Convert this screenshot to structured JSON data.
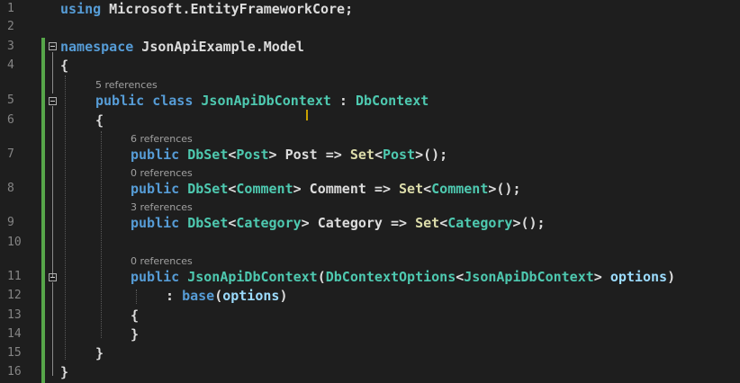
{
  "line_numbers": [
    "1",
    "2",
    "3",
    "4",
    "5",
    "6",
    "7",
    "8",
    "9",
    "10",
    "11",
    "12",
    "13",
    "14",
    "15",
    "16"
  ],
  "lines": {
    "l1": {
      "kw": "using",
      "rest": " Microsoft.EntityFrameworkCore;"
    },
    "l3": {
      "kw": "namespace",
      "rest": " JsonApiExample.Model"
    },
    "l4": {
      "text": "{"
    },
    "l5": {
      "ref": "5 references",
      "kw1": "public",
      "kw2": " class",
      "name": " JsonApiDbContext",
      "colon": " : ",
      "base": "DbContext"
    },
    "l6": {
      "text": "{"
    },
    "l7": {
      "ref": "6 references",
      "kw": "public",
      "t1": " DbSet",
      "lt": "<",
      "t2": "Post",
      "gt": ">",
      "rest": " Post => ",
      "set": "Set",
      "lt2": "<",
      "t3": "Post",
      "end": ">();"
    },
    "l8": {
      "ref": "0 references",
      "kw": "public",
      "t1": " DbSet",
      "lt": "<",
      "t2": "Comment",
      "gt": ">",
      "rest": " Comment => ",
      "set": "Set",
      "lt2": "<",
      "t3": "Comment",
      "end": ">();"
    },
    "l9": {
      "ref": "3 references",
      "kw": "public",
      "t1": " DbSet",
      "lt": "<",
      "t2": "Category",
      "gt": ">",
      "rest": " Category => ",
      "set": "Set",
      "lt2": "<",
      "t3": "Category",
      "end": ">();"
    },
    "l11": {
      "ref": "0 references",
      "kw": "public",
      "name": " JsonApiDbContext",
      "open": "(",
      "t1": "DbContextOptions",
      "lt": "<",
      "t2": "JsonApiDbContext",
      "gt": ">",
      "param": " options",
      "close": ")"
    },
    "l12": {
      "colon": ": ",
      "kw": "base",
      "open": "(",
      "param": "options",
      "close": ")"
    },
    "l13": {
      "text": "{"
    },
    "l14": {
      "text": "}"
    },
    "l15": {
      "text": "}"
    },
    "l16": {
      "text": "}"
    }
  }
}
